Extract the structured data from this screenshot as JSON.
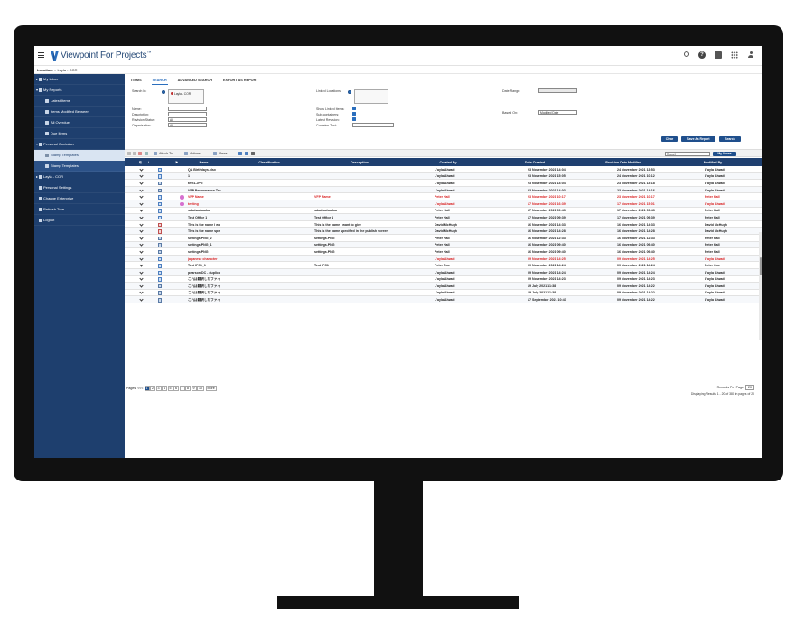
{
  "app": {
    "title": "Viewpoint For Projects",
    "trademark": "™"
  },
  "location": {
    "label": "Location:",
    "path": "Layla - COR"
  },
  "sidebar": {
    "items": [
      {
        "label": "My Inbox"
      },
      {
        "label": "My Reports"
      },
      {
        "label": "Latest Items"
      },
      {
        "label": "Items Modified Between"
      },
      {
        "label": "All Overdue"
      },
      {
        "label": "Due Items"
      },
      {
        "label": "Personal Container"
      },
      {
        "label": "Stamp Templates"
      },
      {
        "label": "Stamp Templates"
      },
      {
        "label": "Layla - COR"
      },
      {
        "label": "Personal Settings"
      },
      {
        "label": "Change Enterprise"
      },
      {
        "label": "Refresh Tree"
      },
      {
        "label": "Logout"
      }
    ]
  },
  "tabs": [
    "ITEMS",
    "SEARCH",
    "ADVANCED SEARCH",
    "EXPORT AS REPORT"
  ],
  "form": {
    "search_in": "Search In:",
    "search_in_value": "Layla - COR",
    "linked_locations": "Linked Locations:",
    "date_range": "Date Range:",
    "name": "Name:",
    "description": "Description:",
    "revision_status": "Revision Status:",
    "revision_status_value": "All",
    "organisation": "Organisation:",
    "organisation_value": "All",
    "show_linked": "Show Linked Items:",
    "sub_containers": "Sub-containers:",
    "latest_revision": "Latest Revision:",
    "contains_text": "Contains Text:",
    "based_on": "Based On:",
    "based_on_value": "Modified Date",
    "btn_clear": "Clear",
    "btn_save": "Save As Report",
    "btn_search": "Search",
    "views_select": "[None]",
    "btn_myviews": "My Views"
  },
  "toolbar": {
    "attach": "Attach To",
    "actions": "Actions",
    "views": "Views"
  },
  "grid": {
    "headers": [
      "Name",
      "Classification",
      "Description",
      "Created By",
      "Date Created",
      "Revision Date Modified",
      "Modified By"
    ],
    "rows": [
      {
        "name": "QA Birthdays.xlsx",
        "cls": "",
        "desc": "",
        "created_by": "L'ayla Alwadi",
        "created": "23 November 2021 14:04",
        "modified": "24 November 2021 13:53",
        "mod_by": "L'ayla Alwadi",
        "icon": "doc",
        "red": false,
        "pink": false
      },
      {
        "name": "1",
        "cls": "",
        "desc": "",
        "created_by": "L'ayla Alwadi",
        "created": "23 November 2021 15:05",
        "modified": "24 November 2021 10:12",
        "mod_by": "L'ayla Alwadi",
        "icon": "doc",
        "red": false,
        "pink": false
      },
      {
        "name": "test1.JPG",
        "cls": "",
        "desc": "",
        "created_by": "L'ayla Alwadi",
        "created": "23 November 2021 14:04",
        "modified": "23 November 2021 14:18",
        "mod_by": "L'ayla Alwadi",
        "icon": "img",
        "red": false,
        "pink": false
      },
      {
        "name": "VFP Performance Tes",
        "cls": "",
        "desc": "",
        "created_by": "L'ayla Alwadi",
        "created": "23 November 2021 14:03",
        "modified": "23 November 2021 14:16",
        "mod_by": "L'ayla Alwadi",
        "icon": "img",
        "red": false,
        "pink": false
      },
      {
        "name": "VFP Name",
        "cls": "VFP Name",
        "desc": "",
        "created_by": "Peter Hall",
        "created": "23 November 2021 10:17",
        "modified": "23 November 2021 10:17",
        "mod_by": "Peter Hall",
        "icon": "doc",
        "red": true,
        "pink": true
      },
      {
        "name": "testing",
        "cls": "",
        "desc": "",
        "created_by": "L'ayla Alwadi",
        "created": "17 November 2021 16:39",
        "modified": "17 November 2021 15:01",
        "mod_by": "L'ayla Alwadi",
        "icon": "doc",
        "red": true,
        "pink": true
      },
      {
        "name": "sdadsadsadsa",
        "cls": "sdadsadsadsa",
        "desc": "",
        "created_by": "Peter Hall",
        "created": "17 November 2021 09:43",
        "modified": "17 November 2021 09:43",
        "mod_by": "Peter Hall",
        "icon": "doc",
        "red": false,
        "pink": false
      },
      {
        "name": "Test Office 1",
        "cls": "Test Office 1",
        "desc": "",
        "created_by": "Peter Hall",
        "created": "17 November 2021 09:39",
        "modified": "17 November 2021 09:39",
        "mod_by": "Peter Hall",
        "icon": "doc",
        "red": false,
        "pink": false
      },
      {
        "name": "This is the name I wa",
        "cls": "This is the name I want to give",
        "desc": "",
        "created_by": "David McHugh",
        "created": "16 November 2021 14:33",
        "modified": "16 November 2021 14:33",
        "mod_by": "David McHugh",
        "icon": "pdf",
        "red": false,
        "pink": false
      },
      {
        "name": "This is the name spe",
        "cls": "This is the name specified in the publish screen",
        "desc": "",
        "created_by": "David McHugh",
        "created": "16 November 2021 14:28",
        "modified": "16 November 2021 14:28",
        "mod_by": "David McHugh",
        "icon": "pdf",
        "red": false,
        "pink": false
      },
      {
        "name": "settings.PNG_2",
        "cls": "settings.PNG",
        "desc": "",
        "created_by": "Peter Hall",
        "created": "16 November 2021 12:33",
        "modified": "16 November 2021 12:33",
        "mod_by": "Peter Hall",
        "icon": "img",
        "red": false,
        "pink": false
      },
      {
        "name": "settings.PNG_1",
        "cls": "settings.PNG",
        "desc": "",
        "created_by": "Peter Hall",
        "created": "16 November 2021 09:40",
        "modified": "16 November 2021 09:40",
        "mod_by": "Peter Hall",
        "icon": "img",
        "red": false,
        "pink": false
      },
      {
        "name": "settings.PNG",
        "cls": "settings.PNG",
        "desc": "",
        "created_by": "Peter Hall",
        "created": "16 November 2021 09:40",
        "modified": "16 November 2021 09:40",
        "mod_by": "Peter Hall",
        "icon": "img",
        "red": false,
        "pink": false
      },
      {
        "name": "japanese character",
        "cls": "",
        "desc": "",
        "created_by": "L'ayla Alwadi",
        "created": "09 November 2021 14:25",
        "modified": "09 November 2021 14:25",
        "mod_by": "L'ayla Alwadi",
        "icon": "doc",
        "red": true,
        "pink": false
      },
      {
        "name": "Test IFC1_1",
        "cls": "Test IFC1",
        "desc": "",
        "created_by": "Peter One",
        "created": "09 November 2021 14:24",
        "modified": "09 November 2021 14:24",
        "mod_by": "Peter One",
        "icon": "doc",
        "red": false,
        "pink": false
      },
      {
        "name": "pearson DC - duplica",
        "cls": "",
        "desc": "",
        "created_by": "L'ayla Alwadi",
        "created": "09 November 2021 14:24",
        "modified": "09 November 2021 14:24",
        "mod_by": "L'ayla Alwadi",
        "icon": "doc",
        "red": false,
        "pink": false
      },
      {
        "name": "これは翻訳したファイ",
        "cls": "",
        "desc": "",
        "created_by": "L'ayla Alwadi",
        "created": "09 November 2021 14:23",
        "modified": "09 November 2021 14:23",
        "mod_by": "L'ayla Alwadi",
        "icon": "doc",
        "red": false,
        "pink": false
      },
      {
        "name": "これは翻訳したファイ",
        "cls": "",
        "desc": "",
        "created_by": "L'ayla Alwadi",
        "created": "19 July 2021 11:38",
        "modified": "09 November 2021 14:22",
        "mod_by": "L'ayla Alwadi",
        "icon": "img",
        "red": false,
        "pink": false
      },
      {
        "name": "これは翻訳したファイ",
        "cls": "",
        "desc": "",
        "created_by": "L'ayla Alwadi",
        "created": "19 July 2021 11:38",
        "modified": "09 November 2021 14:22",
        "mod_by": "L'ayla Alwadi",
        "icon": "img",
        "red": false,
        "pink": false
      },
      {
        "name": "これは翻訳したファイ",
        "cls": "",
        "desc": "",
        "created_by": "L'ayla Alwadi",
        "created": "17 September 2021 10:43",
        "modified": "09 November 2021 14:22",
        "mod_by": "L'ayla Alwadi",
        "icon": "img",
        "red": false,
        "pink": false
      }
    ]
  },
  "pager": {
    "label": "Pages:",
    "prev": "<<<",
    "pages": [
      "1",
      "2",
      "3",
      "4",
      "5",
      "6",
      "7",
      "8",
      "9",
      "10"
    ],
    "more": "More",
    "records_label": "Records Per Page:",
    "records_value": "20",
    "displaying": "Displaying Results 1 - 20 of 380 in pages of 20"
  },
  "colors": {
    "sidebar": "#1e3f6e",
    "grid_header": "#1f4070",
    "accent": "#2a6ebd",
    "red_row": "#d92222"
  }
}
